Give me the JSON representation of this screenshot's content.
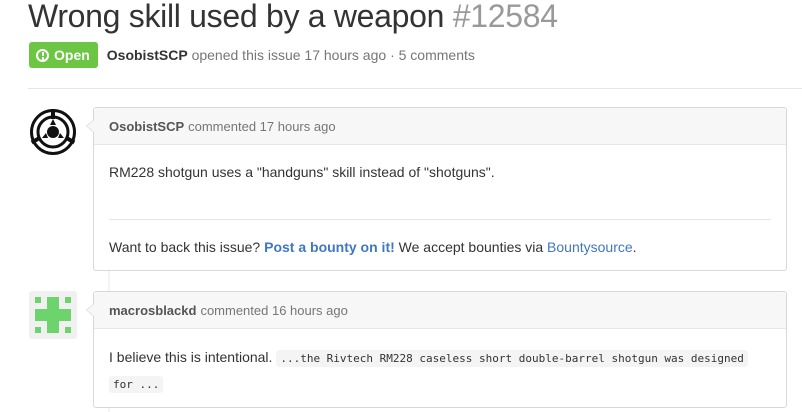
{
  "issue": {
    "title": "Wrong skill used by a weapon",
    "number": "#12584",
    "state": "Open",
    "author": "OsobistSCP",
    "opened_text": "opened this issue 17 hours ago",
    "separator": "·",
    "comments_count": "5 comments"
  },
  "colors": {
    "open_badge": "#6cc644",
    "link": "#4078c0"
  },
  "comments": [
    {
      "author": "OsobistSCP",
      "meta": "commented 17 hours ago",
      "avatar_icon": "scp-foundation-logo-icon",
      "body": "RM228 shotgun uses a \"handguns\" skill instead of \"shotguns\".",
      "bounty_prefix": "Want to back this issue?",
      "bounty_link": "Post a bounty on it!",
      "bounty_middle": "We accept bounties via",
      "bounty_source": "Bountysource",
      "bounty_suffix": "."
    },
    {
      "author": "macrosblackd",
      "meta": "commented 16 hours ago",
      "avatar_icon": "identicon-avatar-icon",
      "body_prefix": "I believe this is intentional.",
      "code_line1": "...the Rivtech RM228 caseless short double-barrel shotgun was designed",
      "code_line2": "for ..."
    }
  ]
}
